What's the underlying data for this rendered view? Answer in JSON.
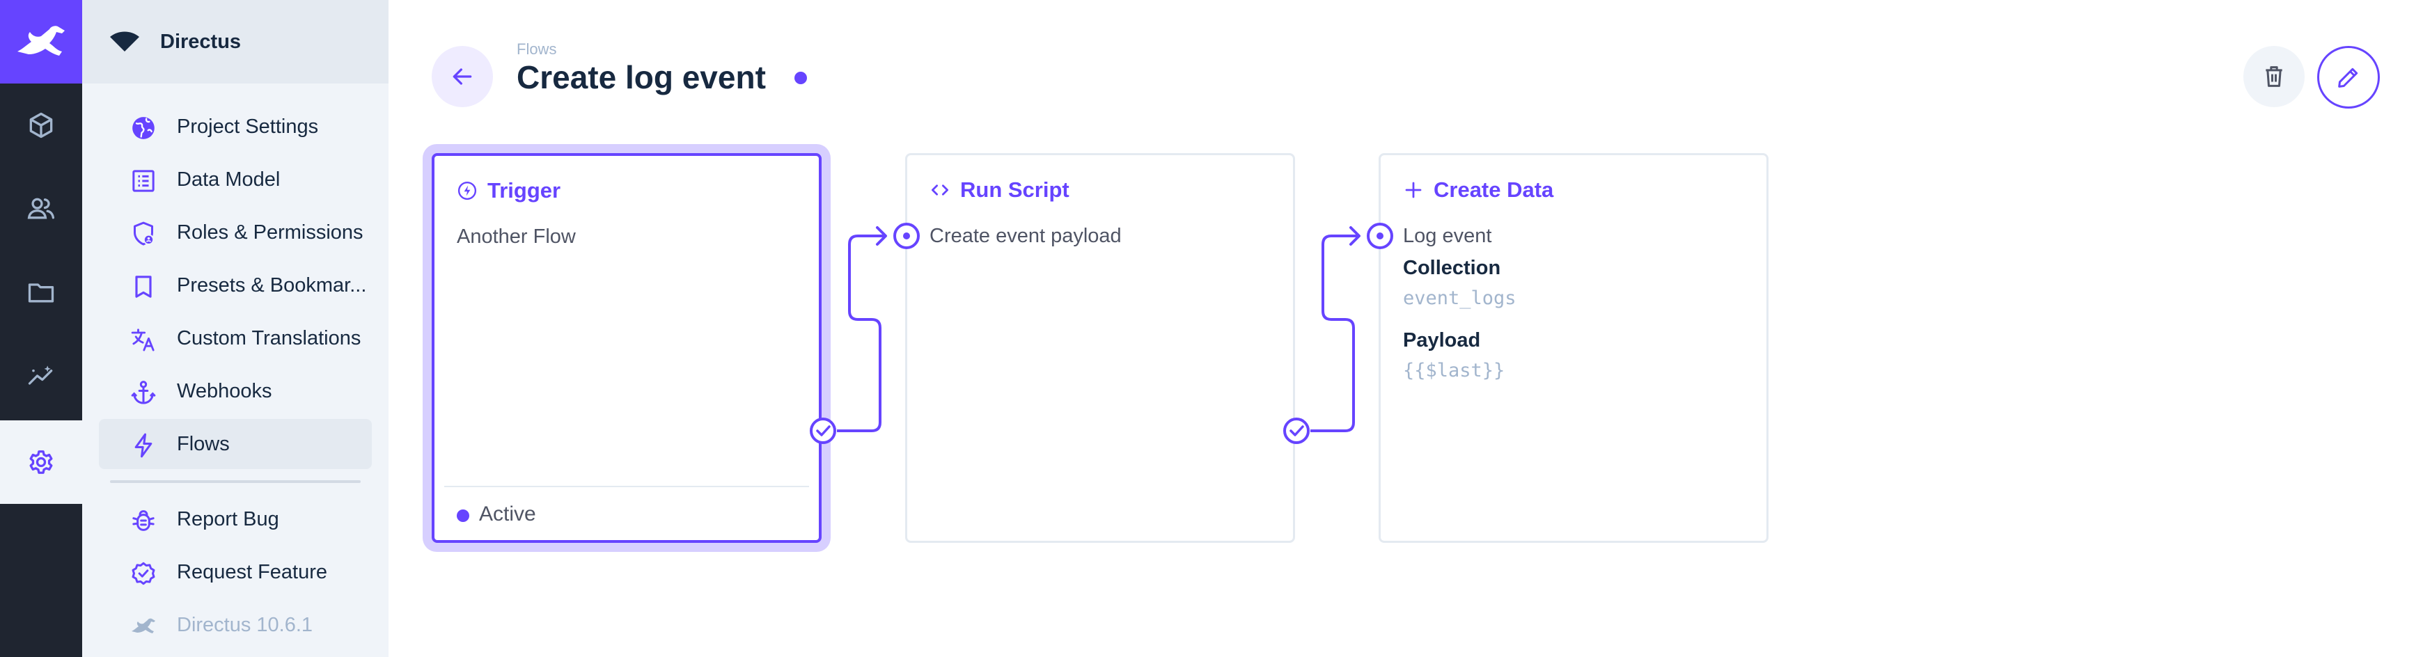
{
  "theme": {
    "accent": "#6644ff",
    "module_bar": "#1f2530",
    "nav_bg": "#f0f4f9",
    "text": "#172940",
    "muted": "#a2b5cd"
  },
  "module_bar": {
    "logo_icon": "directus-rabbit-logo",
    "modules": [
      {
        "icon": "cube-icon",
        "label": "Content"
      },
      {
        "icon": "users-icon",
        "label": "User Directory"
      },
      {
        "icon": "folder-icon",
        "label": "File Library"
      },
      {
        "icon": "insights-icon",
        "label": "Insights"
      },
      {
        "icon": "gear-icon",
        "label": "Settings",
        "active": true
      }
    ]
  },
  "nav": {
    "project_name": "Directus",
    "items": [
      {
        "label": "Project Settings",
        "icon": "globe-icon"
      },
      {
        "label": "Data Model",
        "icon": "list-alt-icon"
      },
      {
        "label": "Roles & Permissions",
        "icon": "admin-shield-icon"
      },
      {
        "label": "Presets & Bookmar...",
        "icon": "bookmark-icon"
      },
      {
        "label": "Custom Translations",
        "icon": "translate-icon"
      },
      {
        "label": "Webhooks",
        "icon": "anchor-icon"
      },
      {
        "label": "Flows",
        "icon": "bolt-icon",
        "active": true
      }
    ],
    "secondary_items": [
      {
        "label": "Report Bug",
        "icon": "bug-icon"
      },
      {
        "label": "Request Feature",
        "icon": "new-releases-icon"
      },
      {
        "label": "Directus 10.6.1",
        "icon": "directus-logo-icon"
      }
    ]
  },
  "header": {
    "breadcrumb": "Flows",
    "title": "Create log event",
    "back_icon": "arrow-back-icon",
    "delete_icon": "trash-icon",
    "edit_icon": "edit-pencil-icon"
  },
  "flow": {
    "trigger": {
      "title": "Trigger",
      "icon": "bolt-circle-icon",
      "name": "Another Flow",
      "status": "Active"
    },
    "operations": [
      {
        "title": "Run Script",
        "icon": "code-icon",
        "name": "Create event payload",
        "options": []
      },
      {
        "title": "Create Data",
        "icon": "plus-icon",
        "name": "Log event",
        "options": [
          {
            "label": "Collection",
            "value": "event_logs"
          },
          {
            "label": "Payload",
            "value": "{{$last}}"
          }
        ]
      }
    ]
  }
}
